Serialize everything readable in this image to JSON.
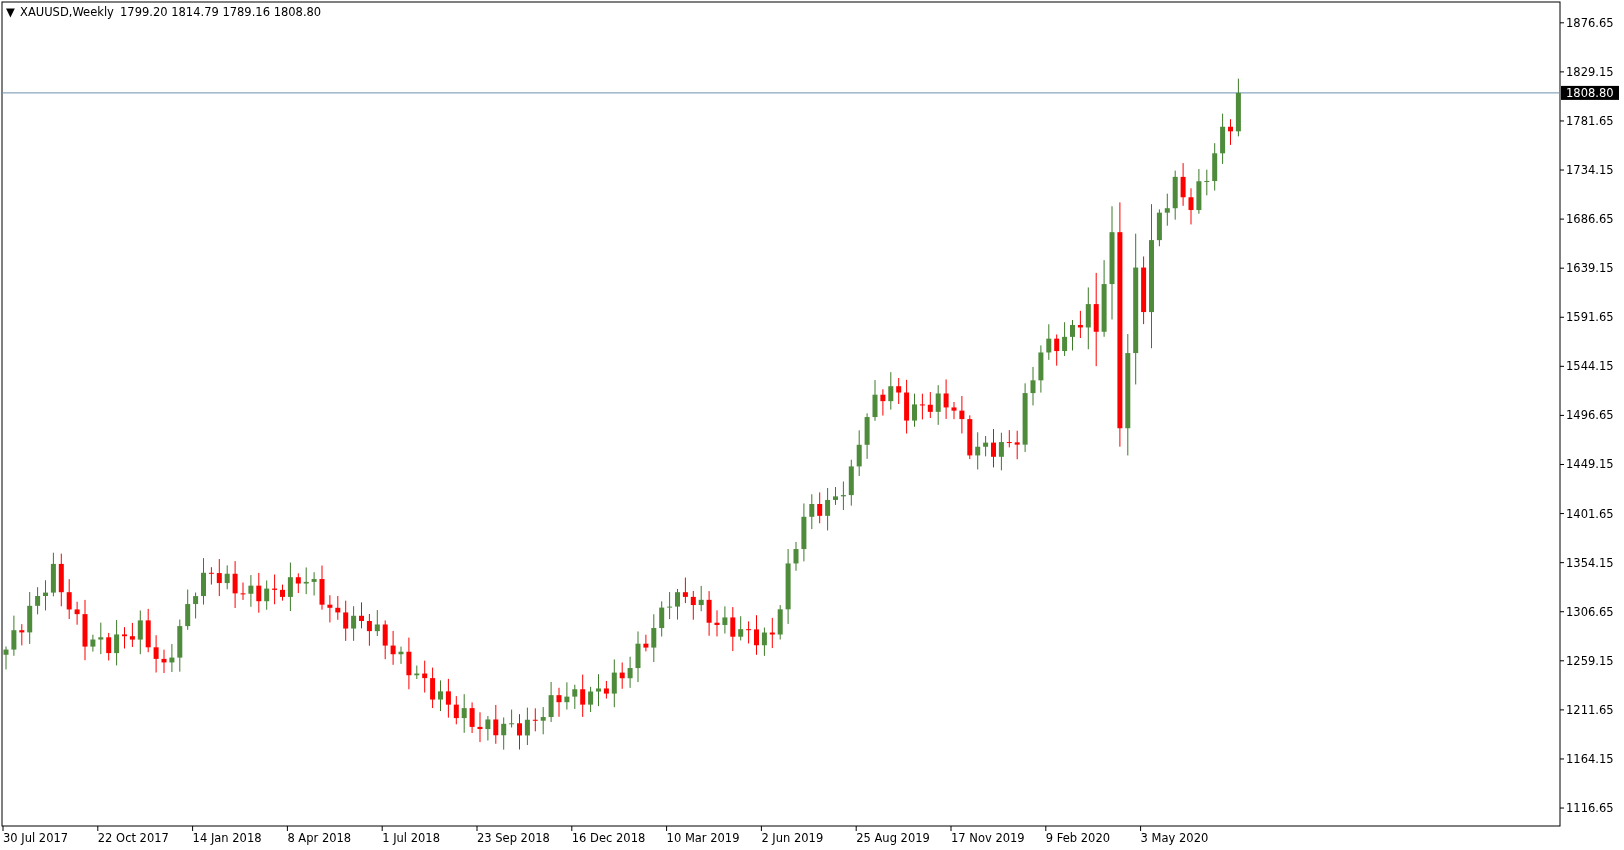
{
  "header": {
    "collapse_icon": "▼",
    "symbol": "XAUUSD,Weekly",
    "ohlc": "1799.20 1814.79 1789.16 1808.80"
  },
  "price_axis": [
    "1876.65",
    "1829.15",
    "1781.65",
    "1734.15",
    "1686.65",
    "1639.15",
    "1591.65",
    "1544.15",
    "1496.65",
    "1449.15",
    "1401.65",
    "1354.15",
    "1306.65",
    "1259.15",
    "1211.65",
    "1164.15",
    "1116.65"
  ],
  "current_price": "1808.80",
  "time_axis": [
    "30 Jul 2017",
    "22 Oct 2017",
    "14 Jan 2018",
    "8 Apr 2018",
    "1 Jul 2018",
    "23 Sep 2018",
    "16 Dec 2018",
    "10 Mar 2019",
    "2 Jun 2019",
    "25 Aug 2019",
    "17 Nov 2019",
    "9 Feb 2020",
    "3 May 2020"
  ]
}
